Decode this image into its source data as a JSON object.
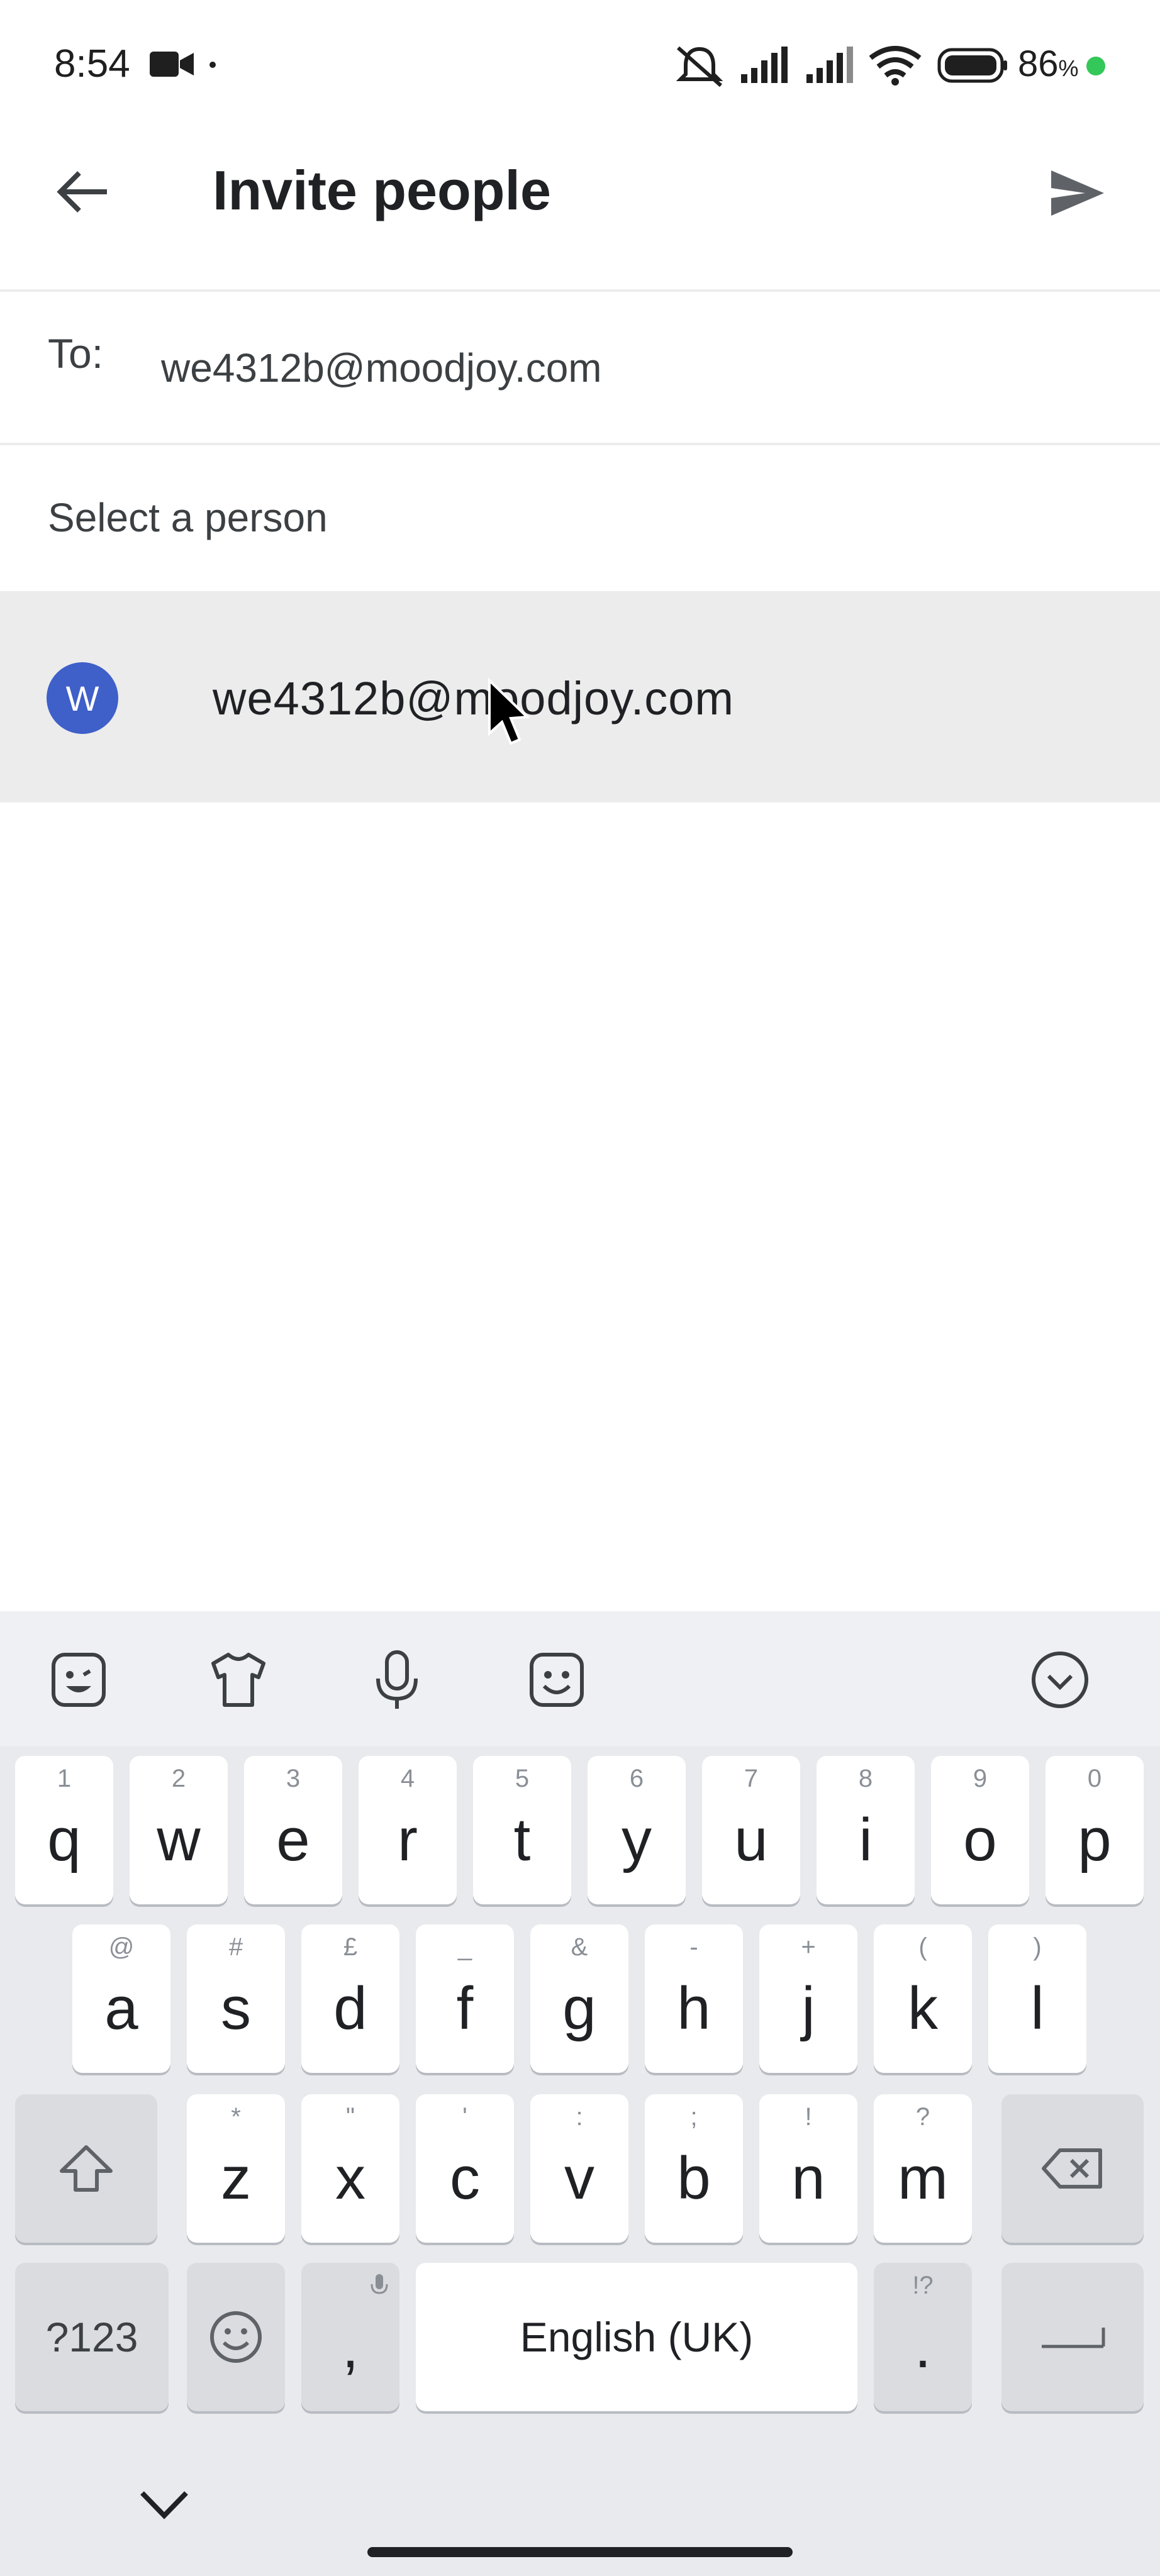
{
  "status_bar": {
    "time": "8:54",
    "battery_percent": "86",
    "battery_unit": "%"
  },
  "app_bar": {
    "title": "Invite people"
  },
  "compose": {
    "to_label": "To:",
    "to_value": "we4312b@moodjoy.com"
  },
  "suggestions": {
    "section_label": "Select a person",
    "items": [
      {
        "avatar_letter": "W",
        "email": "we4312b@moodjoy.com"
      }
    ]
  },
  "keyboard": {
    "row1": [
      {
        "key": "q",
        "hint": "1"
      },
      {
        "key": "w",
        "hint": "2"
      },
      {
        "key": "e",
        "hint": "3"
      },
      {
        "key": "r",
        "hint": "4"
      },
      {
        "key": "t",
        "hint": "5"
      },
      {
        "key": "y",
        "hint": "6"
      },
      {
        "key": "u",
        "hint": "7"
      },
      {
        "key": "i",
        "hint": "8"
      },
      {
        "key": "o",
        "hint": "9"
      },
      {
        "key": "p",
        "hint": "0"
      }
    ],
    "row2": [
      {
        "key": "a",
        "hint": "@"
      },
      {
        "key": "s",
        "hint": "#"
      },
      {
        "key": "d",
        "hint": "£"
      },
      {
        "key": "f",
        "hint": "_"
      },
      {
        "key": "g",
        "hint": "&"
      },
      {
        "key": "h",
        "hint": "-"
      },
      {
        "key": "j",
        "hint": "+"
      },
      {
        "key": "k",
        "hint": "("
      },
      {
        "key": "l",
        "hint": ")"
      }
    ],
    "row3": [
      {
        "key": "z",
        "hint": "*"
      },
      {
        "key": "x",
        "hint": "\""
      },
      {
        "key": "c",
        "hint": "'"
      },
      {
        "key": "v",
        "hint": ":"
      },
      {
        "key": "b",
        "hint": ";"
      },
      {
        "key": "n",
        "hint": "!"
      },
      {
        "key": "m",
        "hint": "?"
      }
    ],
    "symbols_key": "?123",
    "comma_key": ",",
    "space_label": "English (UK)",
    "period_key": ".",
    "period_hint": "!?"
  }
}
